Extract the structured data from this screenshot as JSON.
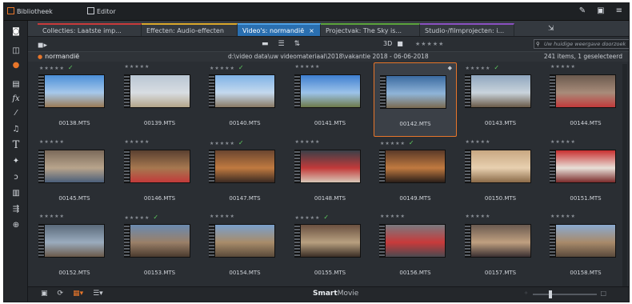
{
  "topbar": {
    "library": "Bibliotheek",
    "editor": "Editor"
  },
  "tabs": [
    {
      "label": "Collecties: Laatste imp...",
      "accent": "#c83a3a"
    },
    {
      "label": "Effecten: Audio-effecten",
      "accent": "#d9a62a"
    },
    {
      "label": "Video's: normandië",
      "close": "×",
      "accent": "#4ea1e6"
    },
    {
      "label": "Projectvak: The Sky is...",
      "accent": "#5aa33a"
    },
    {
      "label": "Studio-/filmprojecten: i...",
      "accent": "#8a4fc0"
    }
  ],
  "toolbar": {
    "label_3d": "3D",
    "stars": "★★★★★",
    "search_placeholder": "Uw huidige weergave doorzoek",
    "folder": "normandië",
    "path": "d:\\video data\\uw videomateriaal\\2018\\vakantie 2018 - 06-06-2018",
    "count": "241 items, 1 geselecteerd"
  },
  "items": [
    {
      "name": "00138.MTS",
      "stars": "★★★★★",
      "check": true
    },
    {
      "name": "00139.MTS",
      "stars": "★★★★★",
      "check": false
    },
    {
      "name": "00140.MTS",
      "stars": "★★★★★",
      "check": true
    },
    {
      "name": "00141.MTS",
      "stars": "★★★★★",
      "check": false
    },
    {
      "name": "00142.MTS",
      "stars": "",
      "check": false,
      "selected": true
    },
    {
      "name": "00143.MTS",
      "stars": "★★★★★",
      "check": true
    },
    {
      "name": "00144.MTS",
      "stars": "★★★★★",
      "check": false
    },
    {
      "name": "00145.MTS",
      "stars": "★★★★★",
      "check": false
    },
    {
      "name": "00146.MTS",
      "stars": "★★★★★",
      "check": false
    },
    {
      "name": "00147.MTS",
      "stars": "★★★★★",
      "check": true
    },
    {
      "name": "00148.MTS",
      "stars": "★★★★★",
      "check": false
    },
    {
      "name": "00149.MTS",
      "stars": "★★★★★",
      "check": true
    },
    {
      "name": "00150.MTS",
      "stars": "★★★★★",
      "check": false
    },
    {
      "name": "00151.MTS",
      "stars": "★★★★★",
      "check": false
    },
    {
      "name": "00152.MTS",
      "stars": "★★★★★",
      "check": false
    },
    {
      "name": "00153.MTS",
      "stars": "★★★★★",
      "check": true
    },
    {
      "name": "00154.MTS",
      "stars": "★★★★★",
      "check": false
    },
    {
      "name": "00155.MTS",
      "stars": "★★★★★",
      "check": true
    },
    {
      "name": "00156.MTS",
      "stars": "★★★★★",
      "check": false
    },
    {
      "name": "00157.MTS",
      "stars": "★★★★★",
      "check": false
    },
    {
      "name": "00158.MTS",
      "stars": "★★★★★",
      "check": false
    }
  ],
  "bottombar": {
    "smart": "Smart",
    "movie": "Movie"
  },
  "colors": {
    "accent": "#e8762a",
    "selected_tab": "#2a6fb0",
    "check": "#5fcf5f"
  }
}
